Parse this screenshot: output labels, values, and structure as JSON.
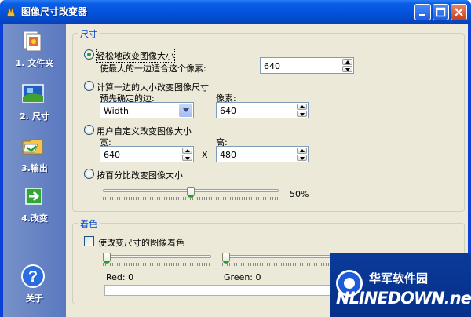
{
  "window": {
    "title": "图像尺寸改变器",
    "colors": {
      "titlebar": "#0453dd",
      "client": "#ece9d8",
      "sidebar": "#6a85c4",
      "legend": "#0046d5"
    }
  },
  "sidebar": {
    "items": [
      {
        "label": "1. 文件夹",
        "icon": "folder-pictures-icon"
      },
      {
        "label": "2. 尺寸",
        "icon": "picture-resize-icon"
      },
      {
        "label": "3.输出",
        "icon": "output-folder-icon"
      },
      {
        "label": "4.改变",
        "icon": "green-arrow-icon"
      },
      {
        "label": "关于",
        "icon": "help-icon"
      }
    ]
  },
  "size_group": {
    "legend": "尺寸",
    "option1": {
      "label": "轻松地改变图像大小",
      "sub_label": "使最大的一边适合这个像素:",
      "value": "640",
      "selected": true
    },
    "option2": {
      "label": "计算一边的大小改变图像尺寸",
      "edge_label": "预先确定的边:",
      "edge_value": "Width",
      "pixels_label": "像素:",
      "pixels_value": "640",
      "selected": false
    },
    "option3": {
      "label": "用户自定义改变图像大小",
      "width_label": "宽:",
      "width_value": "640",
      "times": "X",
      "height_label": "高:",
      "height_value": "480",
      "selected": false
    },
    "option4": {
      "label": "按百分比改变图像大小",
      "percent": 50,
      "percent_text": "50%",
      "selected": false
    }
  },
  "color_group": {
    "legend": "着色",
    "checkbox_label": "使改变尺寸的图像着色",
    "checked": false,
    "red_label": "Red: 0",
    "red": 0,
    "green_label": "Green: 0",
    "green": 0
  },
  "watermark": {
    "cn": "华军软件园",
    "en": "NLINEDOWN.net"
  }
}
